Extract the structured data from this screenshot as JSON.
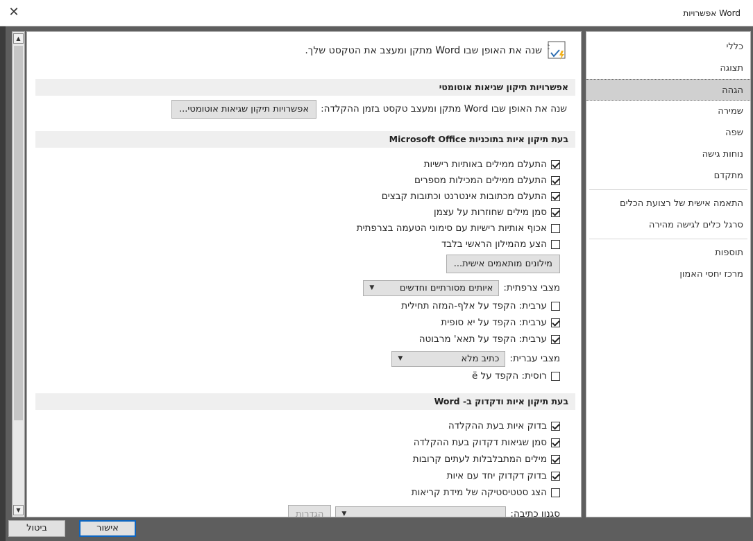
{
  "window": {
    "title": "אפשרויות Word",
    "close_glyph": "✕"
  },
  "sidebar": {
    "items": [
      {
        "label": "כללי"
      },
      {
        "label": "תצוגה"
      },
      {
        "label": "הגהה",
        "active": true
      },
      {
        "label": "שמירה"
      },
      {
        "label": "שפה"
      },
      {
        "label": "נוחות גישה"
      },
      {
        "label": "מתקדם"
      },
      {
        "label": "התאמה אישית של רצועת הכלים"
      },
      {
        "label": "סרגל כלים לגישה מהירה"
      },
      {
        "label": "תוספות"
      },
      {
        "label": "מרכז יחסי האמון"
      }
    ]
  },
  "main": {
    "header_text": "שנה את האופן שבו Word מתקן ומעצב את הטקסט שלך.",
    "header_icon": "abc-spellcheck-icon",
    "autocorrect": {
      "title": "אפשרויות תיקון שגיאות אוטומטי",
      "desc": "שנה את האופן שבו Word מתקן ומעצב טקסט בזמן ההקלדה:",
      "button": "אפשרויות תיקון שגיאות אוטומטי..."
    },
    "office_spelling": {
      "title": "בעת תיקון איות בתוכניות Microsoft Office",
      "checks": [
        {
          "label": "התעלם ממילים באותיות רישיות",
          "checked": true
        },
        {
          "label": "התעלם ממילים המכילות מספרים",
          "checked": true
        },
        {
          "label": "התעלם מכתובות אינטרנט וכתובות קבצים",
          "checked": true
        },
        {
          "label": "סמן מילים שחוזרות על עצמן",
          "checked": true
        },
        {
          "label": "אכוף אותיות רישיות עם סימוני הטעמה בצרפתית",
          "checked": false
        },
        {
          "label": "הצע מהמילון הראשי בלבד",
          "checked": false
        }
      ],
      "custom_dict_button": "מילונים מותאמים אישית...",
      "french_modes_label": "מצבי צרפתית:",
      "french_modes_value": "איותים מסורתיים וחדשים",
      "arabic_checks": [
        {
          "label": "ערבית: הקפד על אלף-המזה תחילית",
          "checked": false
        },
        {
          "label": "ערבית: הקפד על יא סופית",
          "checked": true
        },
        {
          "label": "ערבית: הקפד על תאא' מרבוטה",
          "checked": true
        }
      ],
      "hebrew_modes_label": "מצבי עברית:",
      "hebrew_modes_value": "כתיב מלא",
      "russian_check": {
        "label": "רוסית: הקפד על ё",
        "checked": false
      }
    },
    "word_spelling": {
      "title": "בעת תיקון איות ודקדוק ב- Word",
      "checks": [
        {
          "label": "בדוק איות בעת ההקלדה",
          "checked": true
        },
        {
          "label": "סמן שגיאות דקדוק בעת ההקלדה",
          "checked": true
        },
        {
          "label": "מילים המתבלבלות לעתים קרובות",
          "checked": true
        },
        {
          "label": "בדוק דקדוק יחד עם איות",
          "checked": true
        },
        {
          "label": "הצג סטטיסטיקה של מידת קריאות",
          "checked": false
        }
      ],
      "writing_style_label": "סגנון כתיבה:",
      "settings_button": "הגדרות"
    }
  },
  "footer": {
    "ok": "אישור",
    "cancel": "ביטול"
  }
}
